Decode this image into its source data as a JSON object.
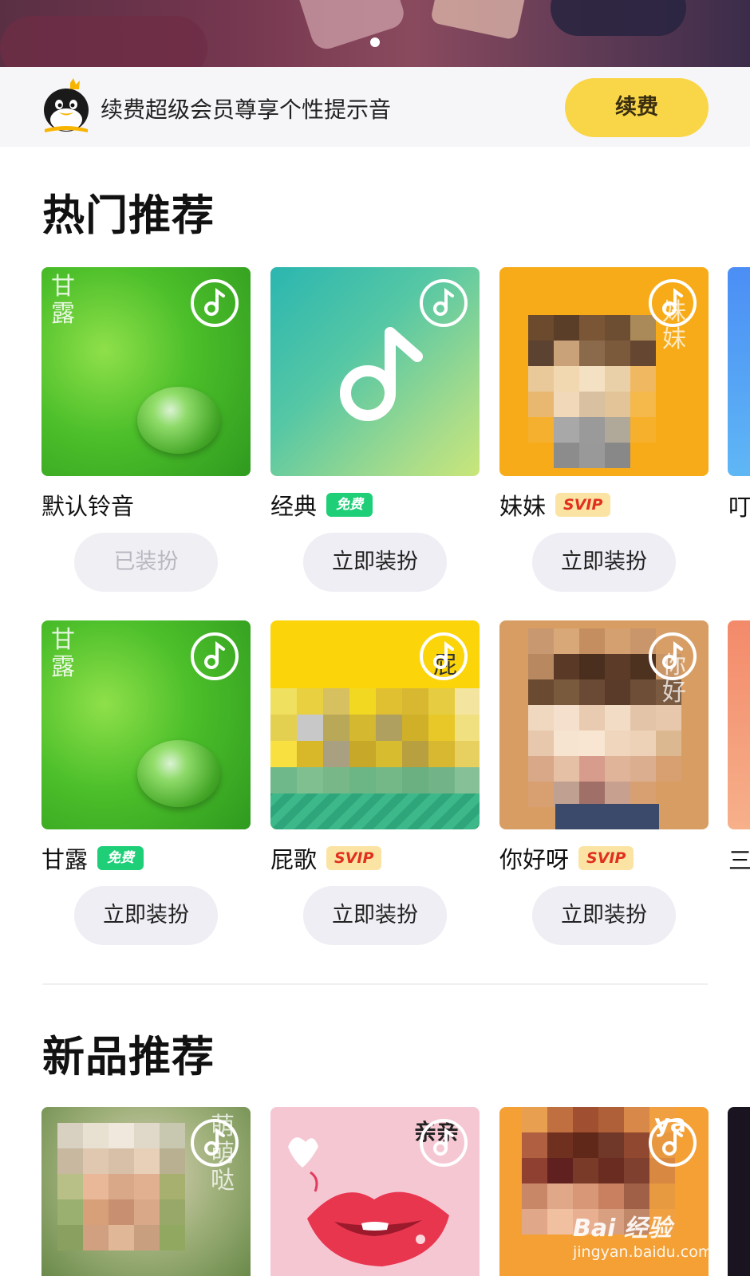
{
  "vip_bar": {
    "message": "续费超级会员尊享个性提示音",
    "renew_label": "续费"
  },
  "hot": {
    "title": "热门推荐",
    "items": [
      {
        "name": "默认铃音",
        "badge": "",
        "action": "已装扮",
        "cover_text": "甘露"
      },
      {
        "name": "经典",
        "badge": "免费",
        "action": "立即装扮",
        "cover_text": ""
      },
      {
        "name": "妹妹",
        "badge": "SVIP",
        "action": "立即装扮",
        "cover_text": "妹妹"
      },
      {
        "name": "甘露",
        "badge": "免费",
        "action": "立即装扮",
        "cover_text": "甘露"
      },
      {
        "name": "屁歌",
        "badge": "SVIP",
        "action": "立即装扮",
        "cover_text": "屁"
      },
      {
        "name": "你好呀",
        "badge": "SVIP",
        "action": "立即装扮",
        "cover_text": "你好"
      }
    ],
    "partial_right": [
      "叮",
      "三"
    ]
  },
  "new": {
    "title": "新品推荐",
    "cover_texts": [
      "萌萌哒",
      "亲亲",
      "ya"
    ]
  },
  "watermark": {
    "brand": "Bai 经验",
    "url": "jingyan.baidu.com"
  },
  "colors": {
    "renew_button": "#f9d648",
    "free_badge": "#1ecf78",
    "svip_badge_bg": "#fbe3a3",
    "svip_badge_text": "#e0301e",
    "action_button": "#eeeef4"
  },
  "icons": [
    "qq-penguin-icon",
    "music-note-icon"
  ]
}
